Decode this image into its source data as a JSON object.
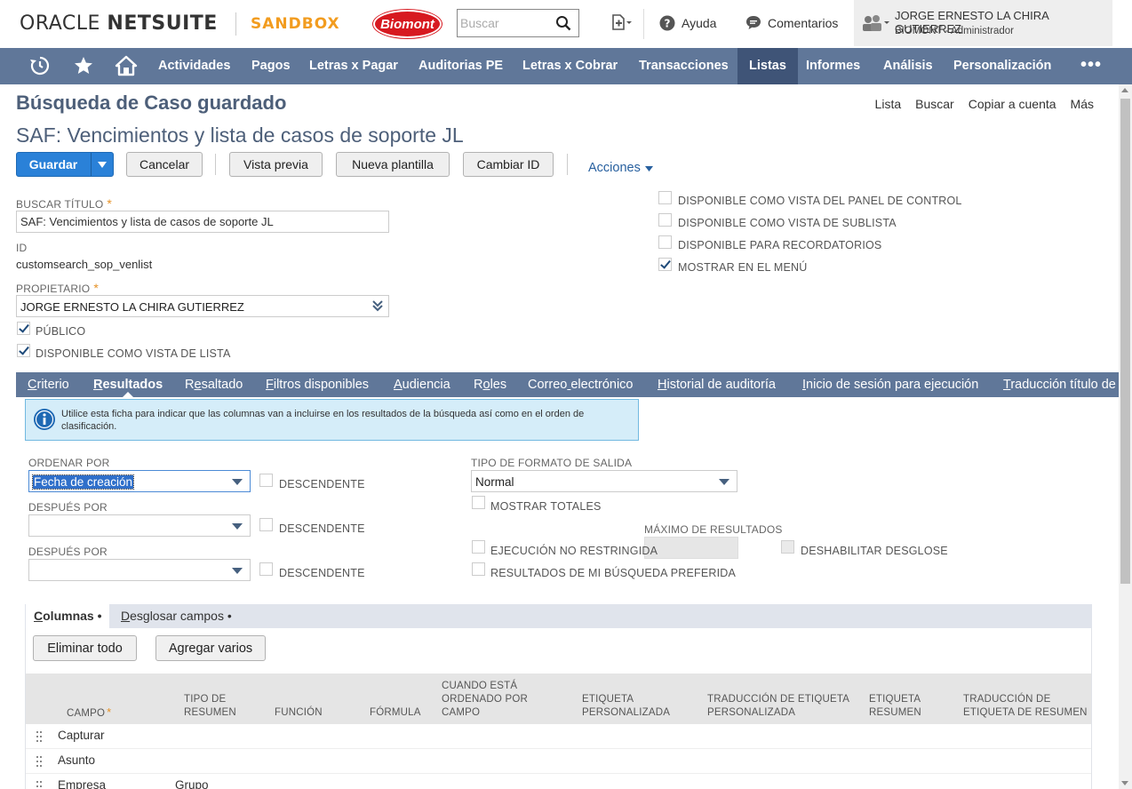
{
  "header": {
    "logo_oracle": "ORACLE",
    "logo_netsuite": "NETSUITE",
    "sandbox_label": "SANDBOX",
    "company_logo_text": "Biomont",
    "search_placeholder": "Buscar",
    "help_label": "Ayuda",
    "comments_label": "Comentarios",
    "user_name": "JORGE ERNESTO LA CHIRA GUTIERREZ",
    "user_role": "BIOMONT - Administrador"
  },
  "nav": {
    "items": [
      "Actividades",
      "Pagos",
      "Letras x Pagar",
      "Auditorias PE",
      "Letras x Cobrar",
      "Transacciones",
      "Listas",
      "Informes",
      "Análisis",
      "Personalización"
    ],
    "active": "Listas",
    "more": "•••"
  },
  "page": {
    "title": "Búsqueda de Caso guardado",
    "record_title": "SAF: Vencimientos y lista de casos de soporte JL",
    "top_links": [
      "Lista",
      "Buscar",
      "Copiar a cuenta",
      "Más"
    ]
  },
  "buttons": {
    "save": "Guardar",
    "cancel": "Cancelar",
    "preview": "Vista previa",
    "new_template": "Nueva plantilla",
    "change_id": "Cambiar ID",
    "actions": "Acciones"
  },
  "fields": {
    "search_title_label": "BUSCAR TÍTULO",
    "search_title_value": "SAF: Vencimientos y lista de casos de soporte JL",
    "id_label": "ID",
    "id_value": "customsearch_sop_venlist",
    "owner_label": "PROPIETARIO",
    "owner_value": "JORGE ERNESTO LA CHIRA GUTIERREZ",
    "public_label": "PÚBLICO",
    "public_checked": true,
    "list_view_label": "DISPONIBLE COMO VISTA DE LISTA",
    "list_view_checked": true,
    "dashboard_label": "DISPONIBLE COMO VISTA DEL PANEL DE CONTROL",
    "dashboard_checked": false,
    "sublist_label": "DISPONIBLE COMO VISTA DE SUBLISTA",
    "sublist_checked": false,
    "reminders_label": "DISPONIBLE PARA RECORDATORIOS",
    "reminders_checked": false,
    "menu_label": "MOSTRAR EN EL MENÚ",
    "menu_checked": true
  },
  "subtabs": {
    "items": [
      "Criterio",
      "Resultados",
      "Resaltado",
      "Filtros disponibles",
      "Audiencia",
      "Roles",
      "Correo electrónico",
      "Historial de auditoría",
      "Inicio de sesión para ejecución",
      "Traducción título de"
    ],
    "active": "Resultados"
  },
  "results": {
    "info_text": "Utilice esta ficha para indicar que las columnas van a incluirse en los resultados de la búsqueda así como en el orden de clasificación.",
    "sort_by_label": "ORDENAR POR",
    "sort_by_value": "Fecha de creación",
    "then_by_label_1": "DESPUÉS POR",
    "then_by_value_1": "",
    "then_by_label_2": "DESPUÉS POR",
    "then_by_value_2": "",
    "descending_label": "DESCENDENTE",
    "output_type_label": "TIPO DE FORMATO DE SALIDA",
    "output_type_value": "Normal",
    "show_totals_label": "MOSTRAR TOTALES",
    "max_results_label": "MÁXIMO DE RESULTADOS",
    "unrestricted_label": "EJECUCIÓN NO RESTRINGIDA",
    "disable_drilldown_label": "DESHABILITAR DESGLOSE",
    "preferred_label": "RESULTADOS DE MI BÚSQUEDA PREFERIDA"
  },
  "columns": {
    "tabs": [
      "Columnas •",
      "Desglosar campos •"
    ],
    "remove_all": "Eliminar todo",
    "add_multiple": "Agregar varios",
    "headers": {
      "field": "CAMPO",
      "summary_type": "TIPO DE RESUMEN",
      "function": "FUNCIÓN",
      "formula": "FÓRMULA",
      "when_ordered": "CUANDO ESTÁ ORDENADO POR CAMPO",
      "custom_label": "ETIQUETA PERSONALIZADA",
      "custom_label_translation": "TRADUCCIÓN DE ETIQUETA PERSONALIZADA",
      "summary_label": "ETIQUETA RESUMEN",
      "summary_label_translation": "TRADUCCIÓN DE ETIQUETA DE RESUMEN"
    },
    "rows": [
      {
        "field": "Capturar",
        "summary": ""
      },
      {
        "field": "Asunto",
        "summary": ""
      },
      {
        "field": "Empresa",
        "summary": "Grupo"
      }
    ]
  },
  "colors": {
    "nav_bg": "#607799",
    "nav_active": "#3f5477",
    "title": "#4d5f79",
    "primary_button": "#2a81d8",
    "sandbox": "#f29c1f",
    "brand_red": "#d71920"
  }
}
